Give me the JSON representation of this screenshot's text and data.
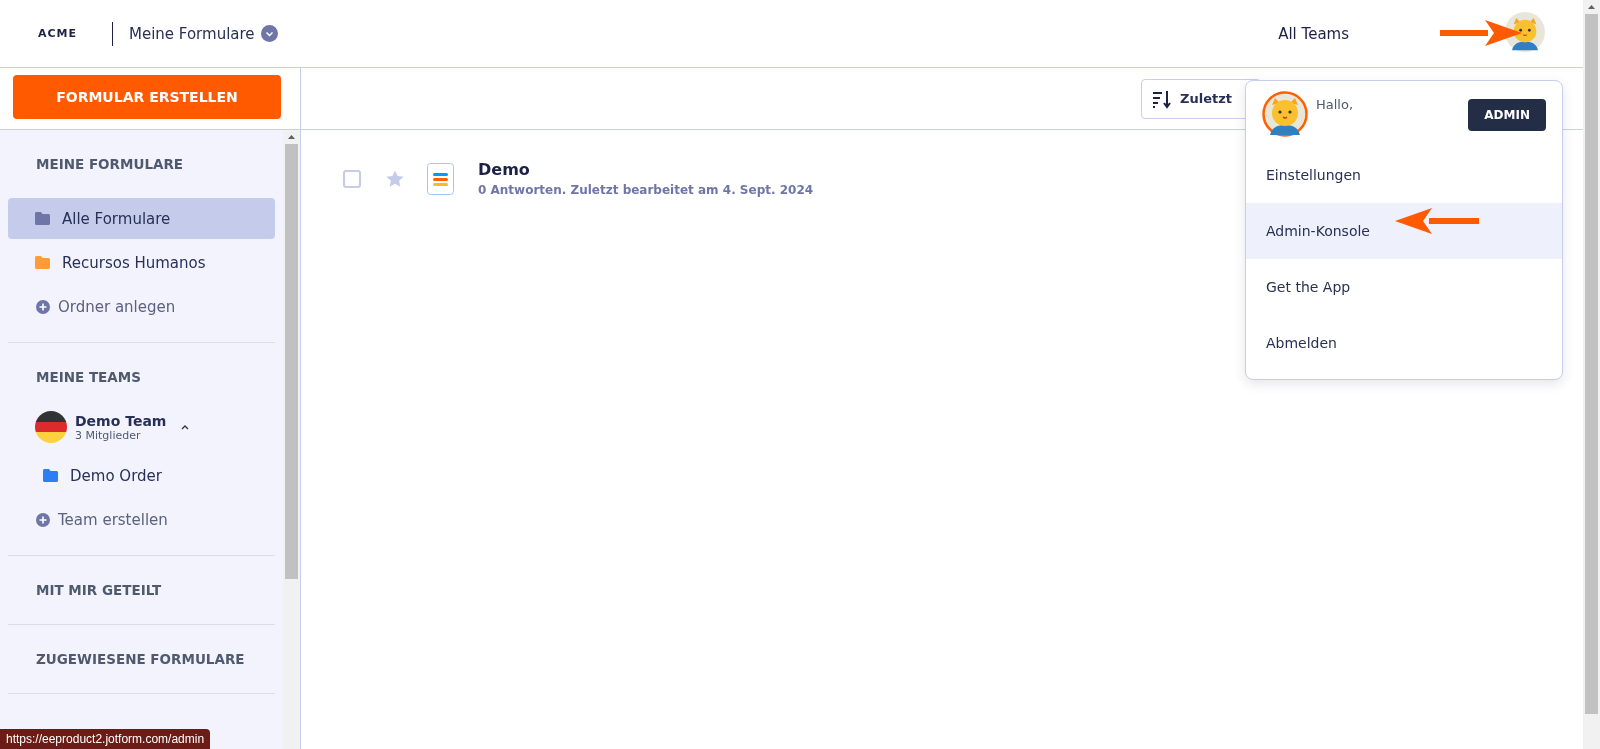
{
  "header": {
    "logo": "ACME",
    "title": "Meine Formulare",
    "teams_link": "All Teams"
  },
  "create_button": "FORMULAR ERSTELLEN",
  "sidebar": {
    "my_forms": {
      "heading": "MEINE FORMULARE",
      "items": [
        {
          "label": "Alle Formulare",
          "color": "#6f76a7",
          "selected": true
        },
        {
          "label": "Recursos Humanos",
          "color": "#ff9c33",
          "selected": false
        }
      ],
      "add": "Ordner anlegen"
    },
    "my_teams": {
      "heading": "MEINE TEAMS",
      "team": {
        "name": "Demo Team",
        "members": "3 Mitglieder",
        "expanded": true
      },
      "items": [
        {
          "label": "Demo Order",
          "color": "#2e7cf6",
          "selected": false
        }
      ],
      "add": "Team erstellen"
    },
    "shared": {
      "heading": "MIT MIR GETEILT"
    },
    "assigned": {
      "heading": "ZUGEWIESENE FORMULARE"
    }
  },
  "toolbar": {
    "sort": "Zuletzt"
  },
  "forms": [
    {
      "title": "Demo",
      "meta": "0 Antworten. Zuletzt bearbeitet am 4. Sept. 2024",
      "checked": false,
      "starred": false
    }
  ],
  "account_menu": {
    "greeting": "Hallo,",
    "badge": "ADMIN",
    "items": [
      {
        "label": "Einstellungen",
        "highlighted": false
      },
      {
        "label": "Admin-Konsole",
        "highlighted": true
      },
      {
        "label": "Get the App",
        "highlighted": false
      },
      {
        "label": "Abmelden",
        "highlighted": false
      }
    ]
  },
  "status_url": "https://eeproduct2.jotform.com/admin"
}
